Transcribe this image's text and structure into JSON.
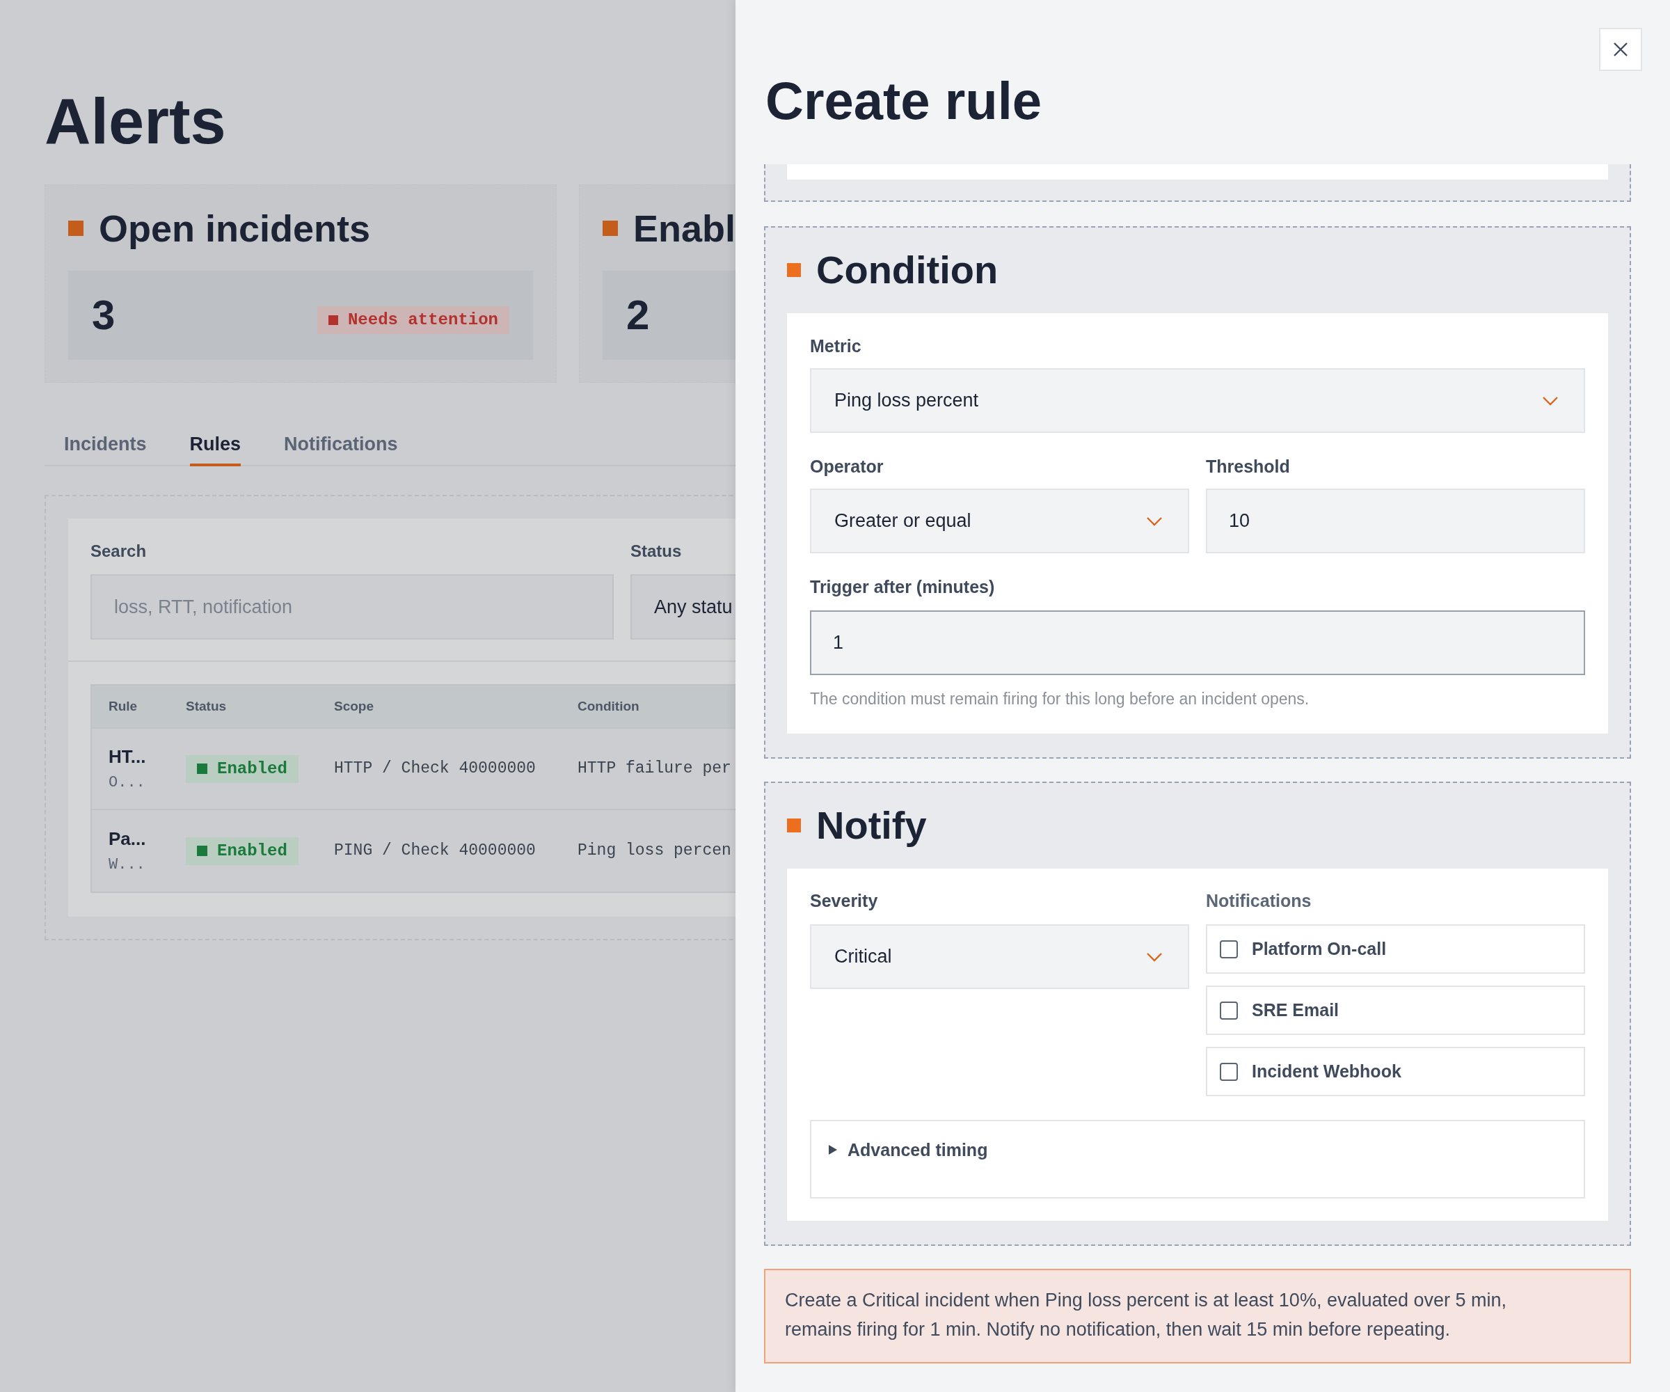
{
  "page": {
    "title": "Alerts"
  },
  "stats": [
    {
      "title": "Open incidents",
      "value": "3",
      "badge": {
        "text": "Needs attention",
        "color": "#b4322d"
      }
    },
    {
      "title": "Enabl",
      "value": "2"
    }
  ],
  "tabs": [
    {
      "label": "Incidents",
      "selected": false
    },
    {
      "label": "Rules",
      "selected": true
    },
    {
      "label": "Notifications",
      "selected": false
    }
  ],
  "filters": {
    "search": {
      "label": "Search",
      "placeholder": "loss, RTT, notification"
    },
    "status": {
      "label": "Status",
      "value": "Any statu"
    }
  },
  "table": {
    "columns": [
      "Rule",
      "Status",
      "Scope",
      "Condition"
    ],
    "rows": [
      {
        "rule": "HT...",
        "rule_detail": "O...",
        "status": "Enabled",
        "color": "#1a7a3c",
        "scope": "HTTP / Check 40000000",
        "condition": "HTTP failure per"
      },
      {
        "rule": "Pa...",
        "rule_detail": "W...",
        "status": "Enabled",
        "color": "#1a7a3c",
        "scope": "PING / Check 40000000",
        "condition": "Ping loss percen"
      }
    ]
  },
  "drawer": {
    "title": "Create rule",
    "condition": {
      "title": "Condition",
      "metric": {
        "label": "Metric",
        "value": "Ping loss percent"
      },
      "operator": {
        "label": "Operator",
        "value": "Greater or equal"
      },
      "threshold": {
        "label": "Threshold",
        "value": "10"
      },
      "trigger": {
        "label": "Trigger after (minutes)",
        "value": "1",
        "hint": "The condition must remain firing for this long before an incident opens."
      }
    },
    "notify": {
      "title": "Notify",
      "severity": {
        "label": "Severity",
        "value": "Critical"
      },
      "notifications_label": "Notifications",
      "notifications": [
        {
          "label": "Platform On-call",
          "checked": false
        },
        {
          "label": "SRE Email",
          "checked": false
        },
        {
          "label": "Incident Webhook",
          "checked": false
        }
      ],
      "advanced": {
        "label": "Advanced timing",
        "expanded": false
      }
    },
    "summary": "Create a Critical incident when Ping loss percent is at least 10%, evaluated over 5 min, remains firing for 1 min. Notify no notification, then wait 15 min before repeating."
  }
}
